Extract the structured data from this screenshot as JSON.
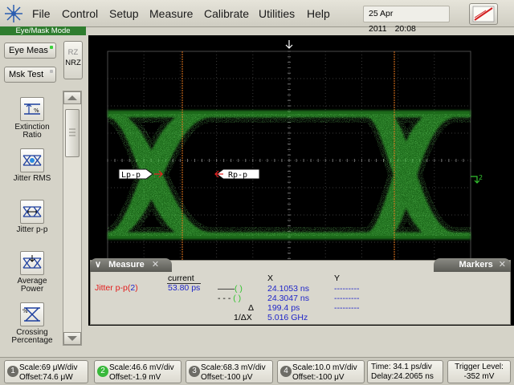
{
  "menu": {
    "items": [
      "File",
      "Control",
      "Setup",
      "Measure",
      "Calibrate",
      "Utilities",
      "Help"
    ],
    "date": "25 Apr 2011",
    "time": "20:08"
  },
  "left_panel": {
    "mode_label": "Eye/Mask Mode",
    "eye_meas_label": "Eye Meas",
    "mask_test_label": "Msk Test",
    "rz_label": "RZ",
    "nrz_label": "NRZ",
    "measurements": [
      {
        "label": "Extinction Ratio",
        "icon": "extinction-ratio-icon"
      },
      {
        "label": "Jitter RMS",
        "icon": "jitter-rms-icon"
      },
      {
        "label": "Jitter p-p",
        "icon": "jitter-pp-icon"
      },
      {
        "label": "Average Power",
        "icon": "average-power-icon"
      },
      {
        "label": "Crossing Percentage",
        "icon": "crossing-percentage-icon"
      }
    ]
  },
  "display": {
    "trace_color": "#34c430",
    "marker_color": "#e8781e",
    "left_marker_label": "Lp-p",
    "right_marker_label": "Rp-p",
    "channel_ref_label": "2"
  },
  "measure_panel": {
    "tab_label": "Measure",
    "markers_tab_label": "Markers",
    "current_header": "current",
    "measurement_name": "Jitter p-p",
    "measurement_channel": "2",
    "measurement_value": "53.80 ps",
    "x_header": "X",
    "y_header": "Y",
    "rows": [
      {
        "label": "( )",
        "x": "24.1053 ns",
        "y": "---------"
      },
      {
        "label": "( )",
        "x": "24.3047 ns",
        "y": "---------"
      },
      {
        "label": "Δ",
        "x": "199.4 ps",
        "y": "---------"
      },
      {
        "label": "1/ΔX",
        "x": "5.016 GHz",
        "y": ""
      }
    ]
  },
  "channels": [
    {
      "num": "1",
      "scale": "Scale:69 μW/div",
      "offset": "Offset:74.6 μW",
      "active": false
    },
    {
      "num": "2",
      "scale": "Scale:46.6 mV/div",
      "offset": "Offset:-1.9 mV",
      "active": true
    },
    {
      "num": "3",
      "scale": "Scale:68.3 mV/div",
      "offset": "Offset:-100 μV",
      "active": false
    },
    {
      "num": "4",
      "scale": "Scale:10.0 mV/div",
      "offset": "Offset:-100 μV",
      "active": false
    }
  ],
  "timebase": {
    "time": "Time: 34.1 ps/div",
    "delay": "Delay:24.2065 ns"
  },
  "trigger": {
    "label": "Trigger Level:",
    "value": "-352 mV"
  }
}
